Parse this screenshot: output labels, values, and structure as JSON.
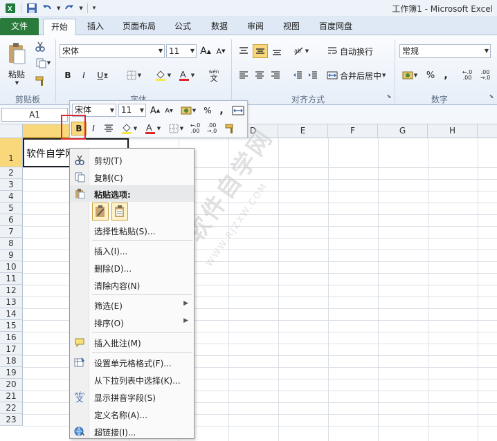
{
  "window": {
    "title": "工作簿1 - Microsoft Excel"
  },
  "tabs": [
    {
      "label": "文件",
      "kind": "file"
    },
    {
      "label": "开始",
      "kind": "active"
    },
    {
      "label": "插入",
      "kind": "normal"
    },
    {
      "label": "页面布局",
      "kind": "normal"
    },
    {
      "label": "公式",
      "kind": "normal"
    },
    {
      "label": "数据",
      "kind": "normal"
    },
    {
      "label": "审阅",
      "kind": "normal"
    },
    {
      "label": "视图",
      "kind": "normal"
    },
    {
      "label": "百度网盘",
      "kind": "normal"
    }
  ],
  "ribbon": {
    "paste_label": "粘贴",
    "font_name": "宋体",
    "font_size": "11",
    "wrap_text": "自动换行",
    "merge_center": "合并后居中",
    "number_format": "常规",
    "groups": {
      "clipboard": "剪贴板",
      "font": "字体",
      "alignment": "对齐方式",
      "number": "数字"
    }
  },
  "formula_bar": {
    "name_box": "A1"
  },
  "grid": {
    "columns": [
      "A",
      "B",
      "C",
      "D",
      "E",
      "F",
      "G",
      "H"
    ],
    "rows": [
      "1",
      "2",
      "3",
      "4",
      "5",
      "6",
      "7",
      "8",
      "9",
      "10",
      "11",
      "12",
      "13",
      "14",
      "15",
      "16",
      "17",
      "18",
      "19",
      "20",
      "21",
      "22",
      "23"
    ],
    "cell_a1": "软件自学网"
  },
  "mini_toolbar": {
    "font_name": "宋体",
    "font_size": "11",
    "bold": "B",
    "italic": "I"
  },
  "context_menu": {
    "cut": "剪切(T)",
    "copy": "复制(C)",
    "paste_options": "粘贴选项:",
    "paste_special": "选择性粘贴(S)...",
    "insert": "插入(I)...",
    "delete": "删除(D)...",
    "clear": "清除内容(N)",
    "filter": "筛选(E)",
    "sort": "排序(O)",
    "insert_comment": "插入批注(M)",
    "format_cells": "设置单元格格式(F)...",
    "pick_list": "从下拉列表中选择(K)...",
    "phonetic": "显示拼音字段(S)",
    "define_name": "定义名称(A)...",
    "hyperlink": "超链接(I)..."
  },
  "watermark": {
    "text": "软件自学网",
    "sub": "WWW.RJZXW.COM"
  },
  "colors": {
    "file_tab": "#2a7a3b",
    "highlight": "#f8d87a",
    "red_box": "#e0262b",
    "font_red": "#e0262b",
    "fill_yellow": "#f5e94a"
  }
}
